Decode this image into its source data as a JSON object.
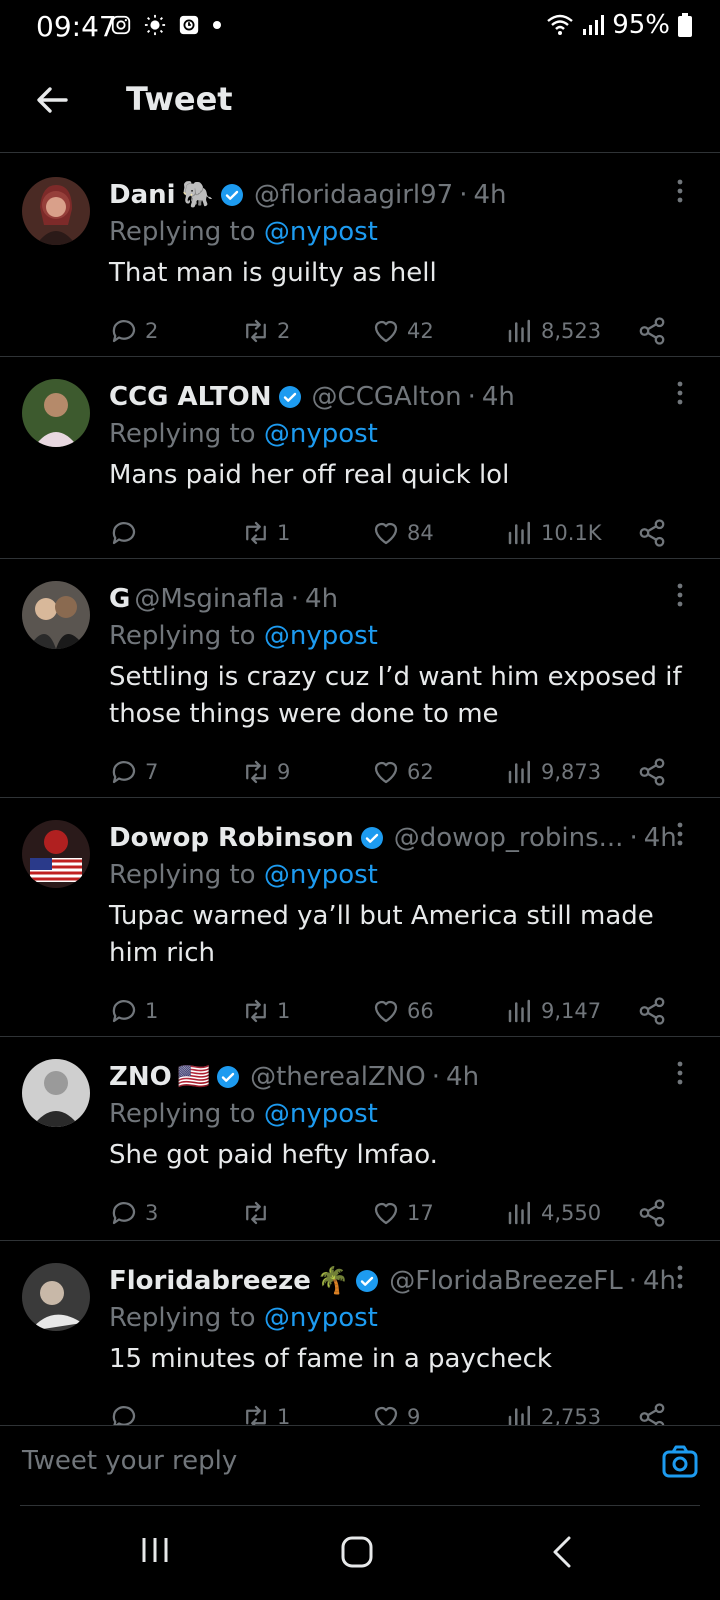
{
  "status_bar": {
    "time": "09:47",
    "battery": "95%"
  },
  "header": {
    "title": "Tweet"
  },
  "tweets": [
    {
      "name": "Dani",
      "emoji": "🐘",
      "verified": true,
      "handle": "@floridaagirl97",
      "time": "4h",
      "replying_prefix": "Replying to",
      "replying_to": "@nypost",
      "text": "That man is guilty as hell",
      "replies": "2",
      "retweets": "2",
      "likes": "42",
      "views": "8,523"
    },
    {
      "name": "CCG ALTON",
      "emoji": "",
      "verified": true,
      "handle": "@CCGAlton",
      "time": "4h",
      "replying_prefix": "Replying to",
      "replying_to": "@nypost",
      "text": "Mans paid her off real quick lol",
      "replies": "",
      "retweets": "1",
      "likes": "84",
      "views": "10.1K"
    },
    {
      "name": "G",
      "emoji": "",
      "verified": false,
      "handle": "@Msginafla",
      "time": "4h",
      "replying_prefix": "Replying to",
      "replying_to": "@nypost",
      "text": "Settling is crazy cuz I’d want him exposed if those things were done to me",
      "replies": "7",
      "retweets": "9",
      "likes": "62",
      "views": "9,873"
    },
    {
      "name": "Dowop Robinson",
      "emoji": "",
      "verified": true,
      "handle": "@dowop_robins...",
      "time": "4h",
      "replying_prefix": "Replying to",
      "replying_to": "@nypost",
      "text": "Tupac warned ya’ll but America still made him rich",
      "replies": "1",
      "retweets": "1",
      "likes": "66",
      "views": "9,147"
    },
    {
      "name": "ZNO",
      "emoji": "🇺🇸",
      "verified": true,
      "handle": "@therealZNO",
      "time": "4h",
      "replying_prefix": "Replying to",
      "replying_to": "@nypost",
      "text": "She got paid hefty lmfao.",
      "replies": "3",
      "retweets": "",
      "likes": "17",
      "views": "4,550"
    },
    {
      "name": "Floridabreeze",
      "emoji": "🌴",
      "verified": true,
      "handle": "@FloridaBreezeFL",
      "time": "4h",
      "replying_prefix": "Replying to",
      "replying_to": "@nypost",
      "text": "15 minutes of fame in a paycheck",
      "replies": "",
      "retweets": "1",
      "likes": "9",
      "views": "2,753"
    }
  ],
  "compose": {
    "placeholder": "Tweet your reply"
  },
  "colors": {
    "background": "#000000",
    "accent": "#1d9bf0",
    "muted": "#71767b",
    "text": "#e7e9ea",
    "divider": "#2f3336"
  },
  "icons": {
    "back": "arrow-left-icon",
    "verified": "verified-badge-icon",
    "more": "more-vertical-icon",
    "reply": "reply-icon",
    "retweet": "retweet-icon",
    "like": "heart-icon",
    "views": "views-icon",
    "share": "share-icon",
    "camera": "camera-icon"
  }
}
